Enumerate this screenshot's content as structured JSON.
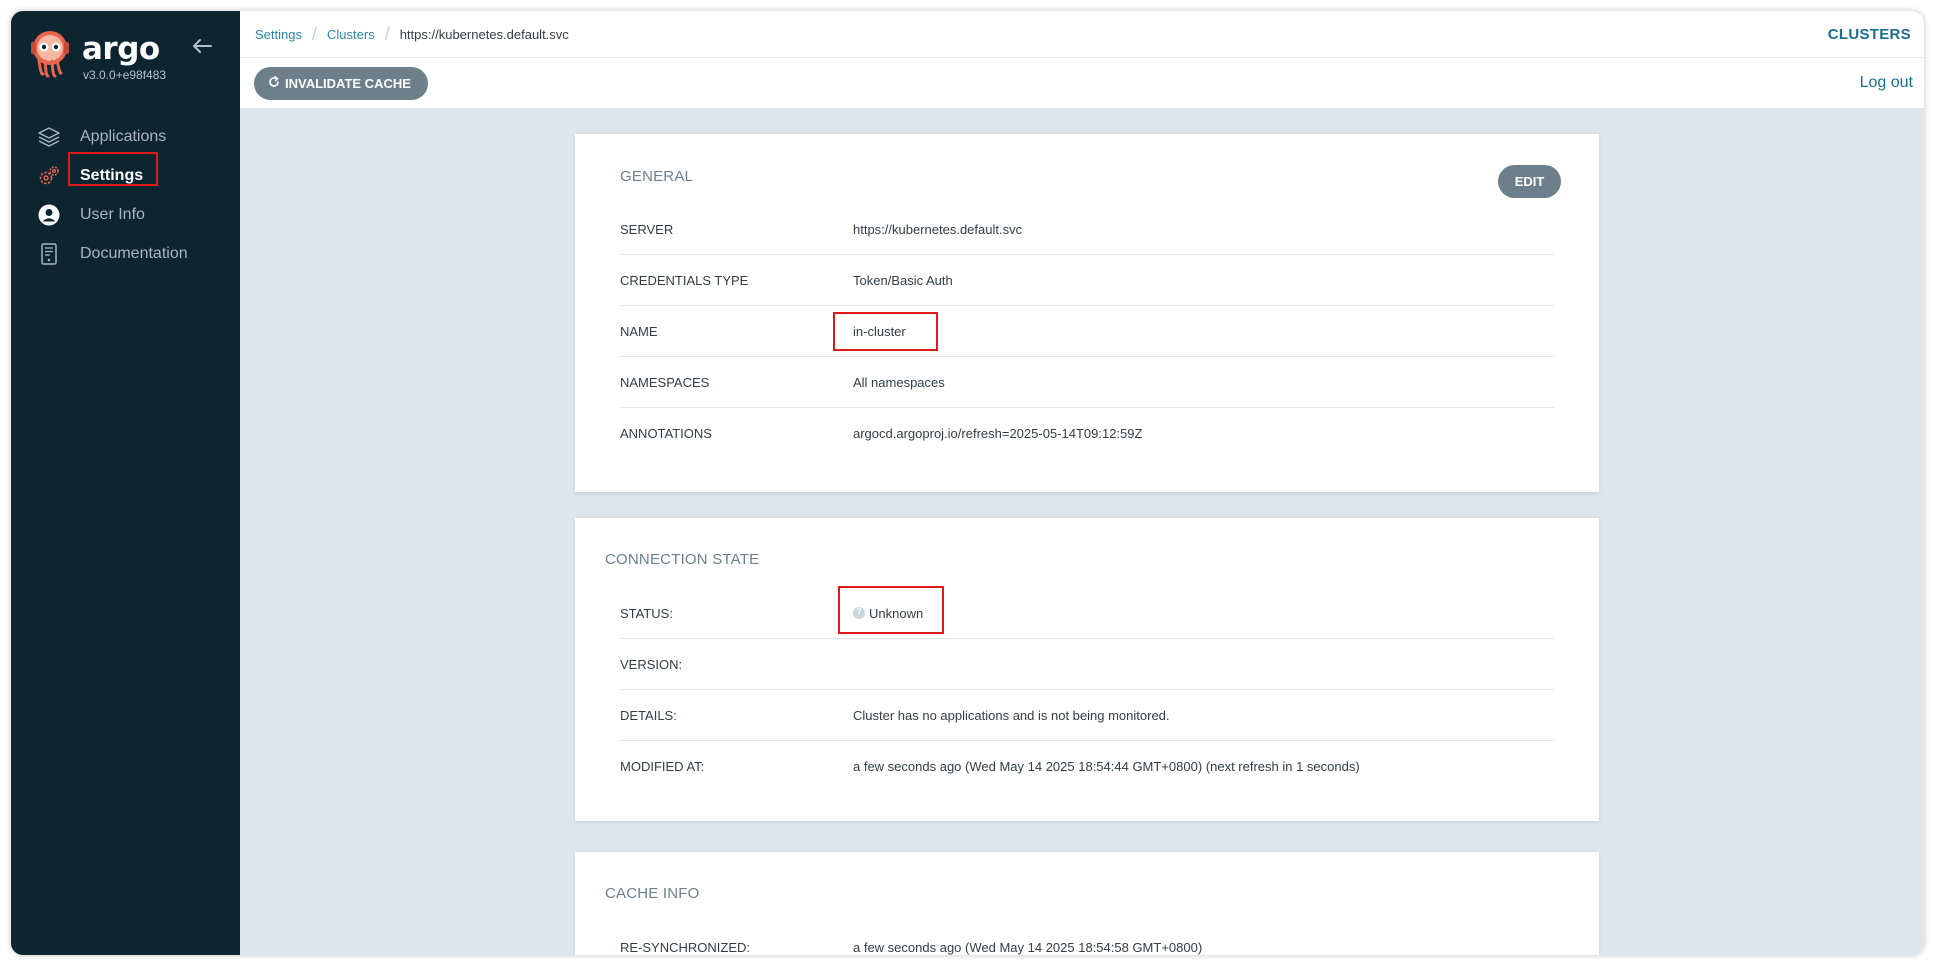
{
  "brand": {
    "name": "argo",
    "version": "v3.0.0+e98f483"
  },
  "sidebar": {
    "items": [
      {
        "label": "Applications",
        "icon": "layers-icon",
        "active": false
      },
      {
        "label": "Settings",
        "icon": "gears-icon",
        "active": true
      },
      {
        "label": "User Info",
        "icon": "user-circle-icon",
        "active": false
      },
      {
        "label": "Documentation",
        "icon": "book-icon",
        "active": false
      }
    ]
  },
  "breadcrumb": {
    "items": [
      "Settings",
      "Clusters"
    ],
    "current": "https://kubernetes.default.svc"
  },
  "header": {
    "title": "CLUSTERS"
  },
  "toolbar": {
    "invalidate_label": "INVALIDATE CACHE",
    "logout_label": "Log out"
  },
  "general": {
    "title": "GENERAL",
    "edit_label": "EDIT",
    "rows": [
      {
        "key": "SERVER",
        "value": "https://kubernetes.default.svc"
      },
      {
        "key": "CREDENTIALS TYPE",
        "value": "Token/Basic Auth"
      },
      {
        "key": "NAME",
        "value": "in-cluster"
      },
      {
        "key": "NAMESPACES",
        "value": "All namespaces"
      },
      {
        "key": "ANNOTATIONS",
        "value": "argocd.argoproj.io/refresh=2025-05-14T09:12:59Z"
      }
    ]
  },
  "connection": {
    "title": "CONNECTION STATE",
    "rows": [
      {
        "key": "STATUS:",
        "value": "Unknown"
      },
      {
        "key": "VERSION:",
        "value": ""
      },
      {
        "key": "DETAILS:",
        "value": "Cluster has no applications and is not being monitored."
      },
      {
        "key": "MODIFIED AT:",
        "value": "a few seconds ago (Wed May 14 2025 18:54:44 GMT+0800) (next refresh in 1 seconds)"
      }
    ]
  },
  "cache": {
    "title": "CACHE INFO",
    "rows": [
      {
        "key": "RE-SYNCHRONIZED:",
        "value": "a few seconds ago (Wed May 14 2025 18:54:58 GMT+0800)"
      }
    ]
  },
  "colors": {
    "sidebar_bg": "#0d2431",
    "accent": "#1c6e8f",
    "button_bg": "#6d7f8b",
    "highlight": "#e01919",
    "content_bg": "#dee6eb"
  }
}
